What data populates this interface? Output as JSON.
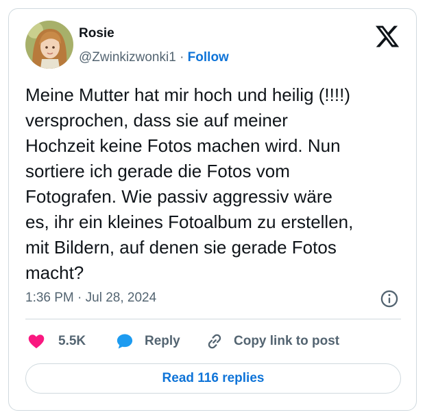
{
  "author": {
    "name": "Rosie",
    "handle": "@Zwinkizwonki1",
    "separator": "·",
    "follow_label": "Follow"
  },
  "tweet": {
    "lines": [
      "Meine Mutter hat mir hoch und heilig (!!!!)",
      "versprochen, dass sie auf meiner",
      "Hochzeit keine Fotos machen wird. Nun",
      "sortiere ich gerade die Fotos vom",
      "Fotografen.  Wie passiv aggressiv wäre",
      "es, ihr ein kleines Fotoalbum zu erstellen,",
      "mit Bildern, auf denen sie gerade Fotos",
      "macht?"
    ],
    "timestamp": "1:36 PM · Jul 28, 2024"
  },
  "actions": {
    "likes_count": "5.5K",
    "reply_label": "Reply",
    "copy_link_label": "Copy link to post"
  },
  "read_replies_label": "Read 116 replies",
  "icons": {
    "logo": "x-logo-icon",
    "info": "info-icon",
    "like": "heart-icon",
    "reply": "speech-bubble-icon",
    "copy": "link-icon"
  },
  "colors": {
    "accent": "#0f74d8",
    "like": "#f91880",
    "reply": "#1d9bf0",
    "muted": "#536471"
  }
}
